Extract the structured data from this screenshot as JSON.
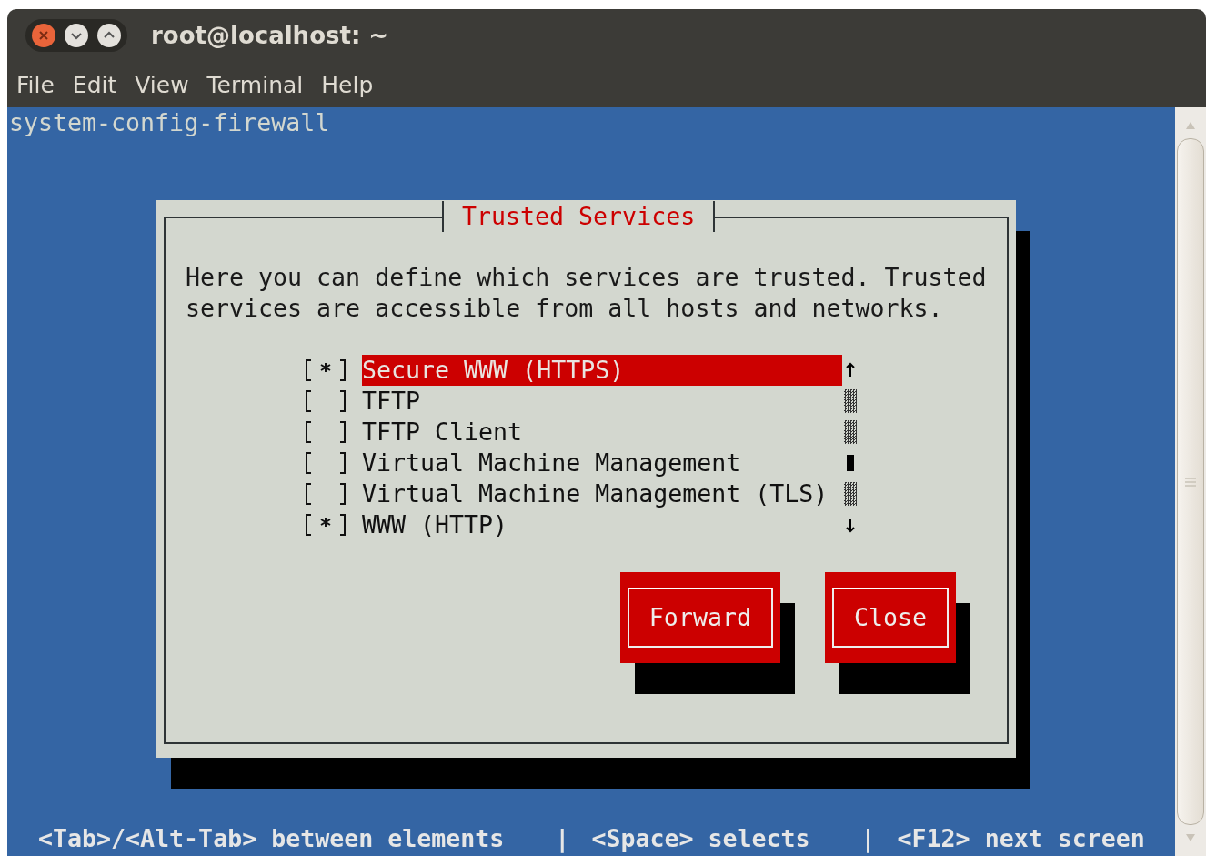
{
  "window": {
    "title": "root@localhost: ~"
  },
  "menu": [
    "File",
    "Edit",
    "View",
    "Terminal",
    "Help"
  ],
  "terminal": {
    "command": "system-config-firewall"
  },
  "dialog": {
    "title": "Trusted Services",
    "description": "Here you can define which services are trusted. Trusted services are accessible from all hosts and networks.",
    "services": [
      {
        "label": "Secure WWW (HTTPS)",
        "checked": true,
        "selected": true
      },
      {
        "label": "TFTP",
        "checked": false,
        "selected": false
      },
      {
        "label": "TFTP Client",
        "checked": false,
        "selected": false
      },
      {
        "label": "Virtual Machine Management",
        "checked": false,
        "selected": false
      },
      {
        "label": "Virtual Machine Management (TLS)",
        "checked": false,
        "selected": false
      },
      {
        "label": "WWW (HTTP)",
        "checked": true,
        "selected": false
      }
    ],
    "buttons": [
      "Forward",
      "Close"
    ]
  },
  "status_bar": {
    "hints": [
      "<Tab>/<Alt-Tab> between elements",
      "<Space> selects",
      "<F12> next screen"
    ],
    "separators": [
      "|",
      "|"
    ]
  }
}
